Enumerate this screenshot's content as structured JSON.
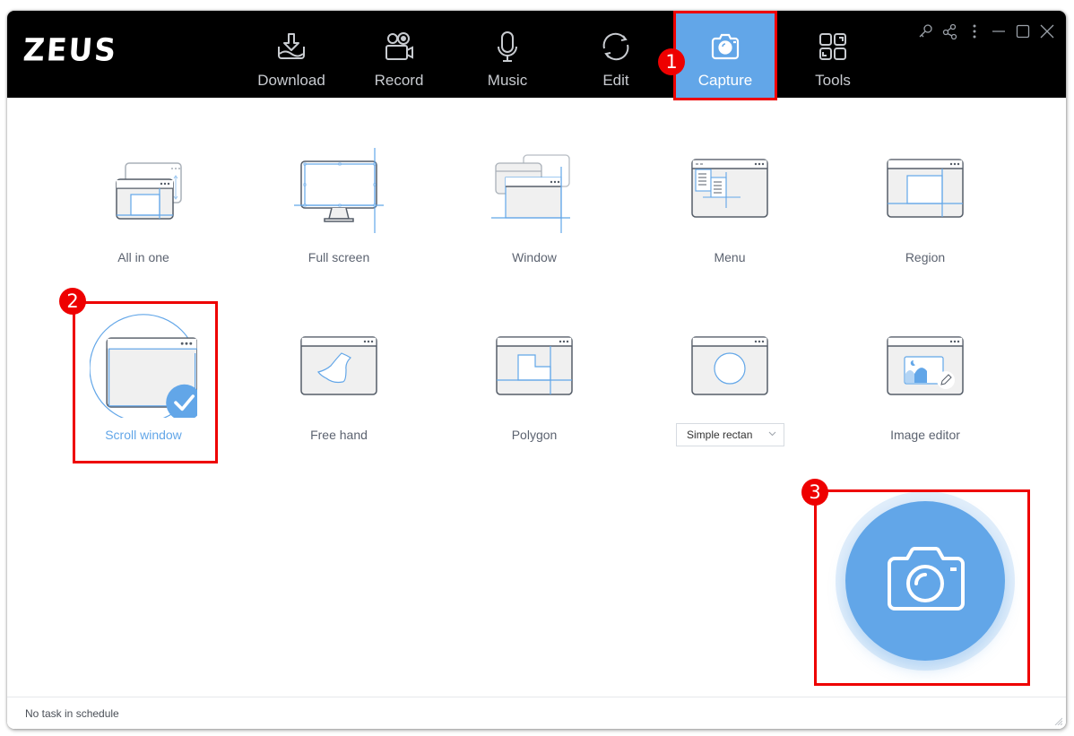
{
  "app": {
    "logo": "ZEUS"
  },
  "nav": {
    "tabs": [
      {
        "label": "Download",
        "icon": "download-icon"
      },
      {
        "label": "Record",
        "icon": "video-camera-icon"
      },
      {
        "label": "Music",
        "icon": "microphone-icon"
      },
      {
        "label": "Edit",
        "icon": "convert-icon"
      },
      {
        "label": "Capture",
        "icon": "camera-icon",
        "active": true
      },
      {
        "label": "Tools",
        "icon": "grid-tools-icon"
      }
    ]
  },
  "window_controls": [
    "key-icon",
    "share-icon",
    "more-icon",
    "minimize-icon",
    "maximize-icon",
    "close-icon"
  ],
  "capture": {
    "modes": [
      {
        "label": "All in one"
      },
      {
        "label": "Full screen"
      },
      {
        "label": "Window"
      },
      {
        "label": "Menu"
      },
      {
        "label": "Region"
      },
      {
        "label": "Scroll window",
        "selected": true
      },
      {
        "label": "Free hand"
      },
      {
        "label": "Polygon"
      },
      {
        "label": ""
      },
      {
        "label": "Image editor"
      }
    ],
    "shape_select": {
      "value": "Simple rectan"
    },
    "capture_button_icon": "camera-icon"
  },
  "status": {
    "text": "No task in schedule"
  },
  "callouts": [
    "1",
    "2",
    "3"
  ],
  "colors": {
    "accent": "#62a6e8",
    "topbar": "#000000",
    "callout": "#ee0000"
  }
}
